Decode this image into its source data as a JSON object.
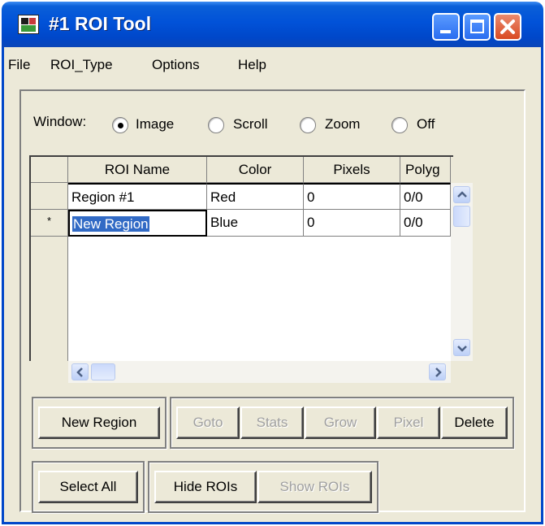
{
  "window": {
    "title": "#1 ROI Tool",
    "accent_color": "#0047c9",
    "close_color": "#d94a22"
  },
  "menu": {
    "items": [
      "File",
      "ROI_Type",
      "Options",
      "Help"
    ]
  },
  "window_selector": {
    "label": "Window:",
    "options": [
      "Image",
      "Scroll",
      "Zoom",
      "Off"
    ],
    "selected": "Image"
  },
  "table": {
    "columns": [
      "ROI Name",
      "Color",
      "Pixels",
      "Polyg"
    ],
    "rows": [
      {
        "marker": "",
        "name": "Region #1",
        "color": "Red",
        "pixels": "0",
        "polygons": "0/0"
      },
      {
        "marker": "*",
        "name": "New Region",
        "color": "Blue",
        "pixels": "0",
        "polygons": "0/0"
      }
    ],
    "editing_cell": "New Region",
    "selection_color": "#316ac5"
  },
  "buttons": {
    "new_region": "New Region",
    "goto": "Goto",
    "stats": "Stats",
    "grow": "Grow",
    "pixel": "Pixel",
    "delete": "Delete",
    "select_all": "Select All",
    "hide_rois": "Hide ROIs",
    "show_rois": "Show ROIs"
  },
  "disabled_buttons": [
    "Goto",
    "Stats",
    "Grow",
    "Pixel",
    "Show ROIs"
  ]
}
